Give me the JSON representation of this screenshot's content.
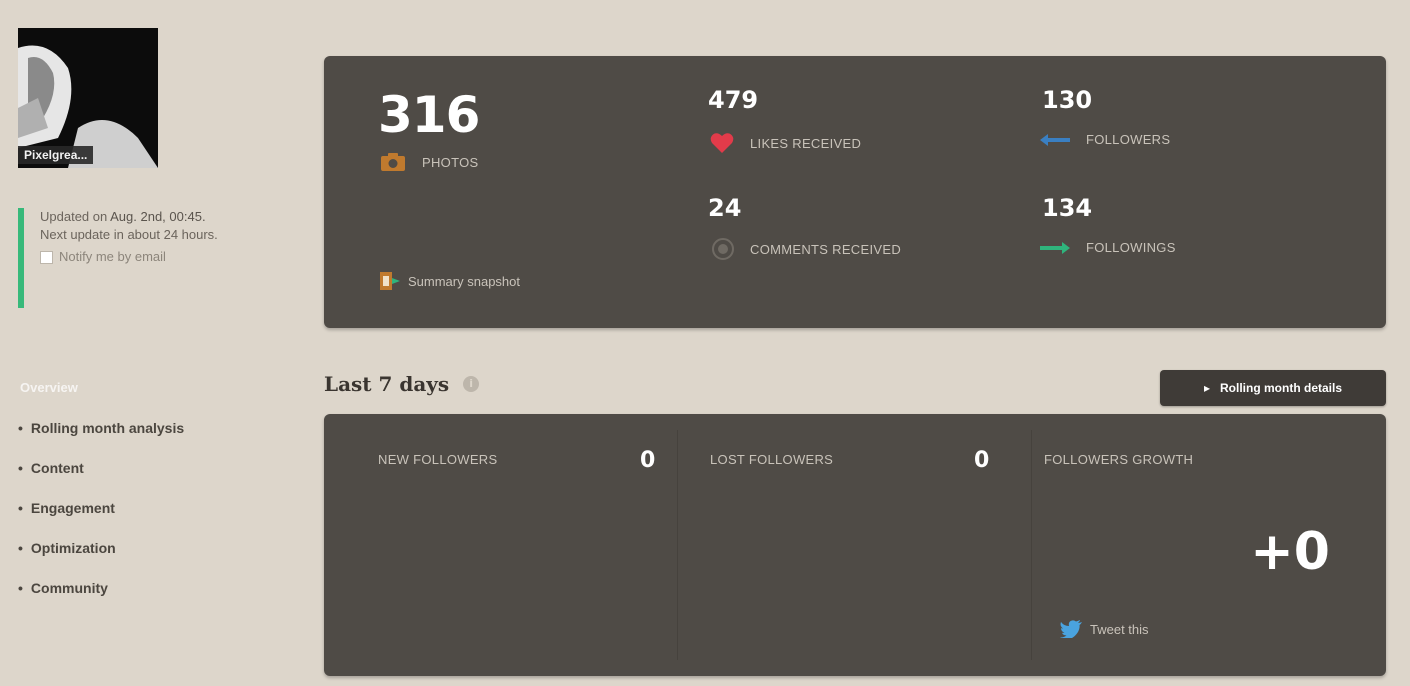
{
  "profile": {
    "username": "Pixelgrea...",
    "avatar_icon": "profile-photo"
  },
  "status": {
    "updated_prefix": "Updated on",
    "updated_date": "Aug. 2nd, 00:45.",
    "next_update": "Next update in about 24 hours.",
    "notify_label": "Notify me by email"
  },
  "nav": {
    "overview": "Overview",
    "items": [
      "Rolling month analysis",
      "Content",
      "Engagement",
      "Optimization",
      "Community"
    ]
  },
  "stats": {
    "photos": {
      "value": "316",
      "label": "PHOTOS",
      "icon": "camera-icon"
    },
    "likes": {
      "value": "479",
      "label": "LIKES RECEIVED",
      "icon": "heart-icon"
    },
    "followers": {
      "value": "130",
      "label": "FOLLOWERS",
      "icon": "arrow-left-icon"
    },
    "comments": {
      "value": "24",
      "label": "COMMENTS RECEIVED",
      "icon": "comment-icon"
    },
    "followings": {
      "value": "134",
      "label": "FOLLOWINGS",
      "icon": "arrow-right-icon"
    },
    "snapshot_label": "Summary snapshot"
  },
  "week": {
    "title": "Last 7 days",
    "rolling_button": "Rolling month details",
    "new_followers": {
      "label": "NEW FOLLOWERS",
      "value": "0"
    },
    "lost_followers": {
      "label": "LOST FOLLOWERS",
      "value": "0"
    },
    "followers_growth": {
      "label": "FOLLOWERS GROWTH",
      "value": "+0"
    },
    "tweet_label": "Tweet this"
  },
  "colors": {
    "background": "#ddd6cb",
    "panel": "#4f4b46",
    "accent_green": "#37b97a",
    "heart_red": "#e23b4a",
    "arrow_blue": "#3a7fc2",
    "arrow_green": "#2fb47c",
    "camera_orange": "#c07a2e"
  }
}
